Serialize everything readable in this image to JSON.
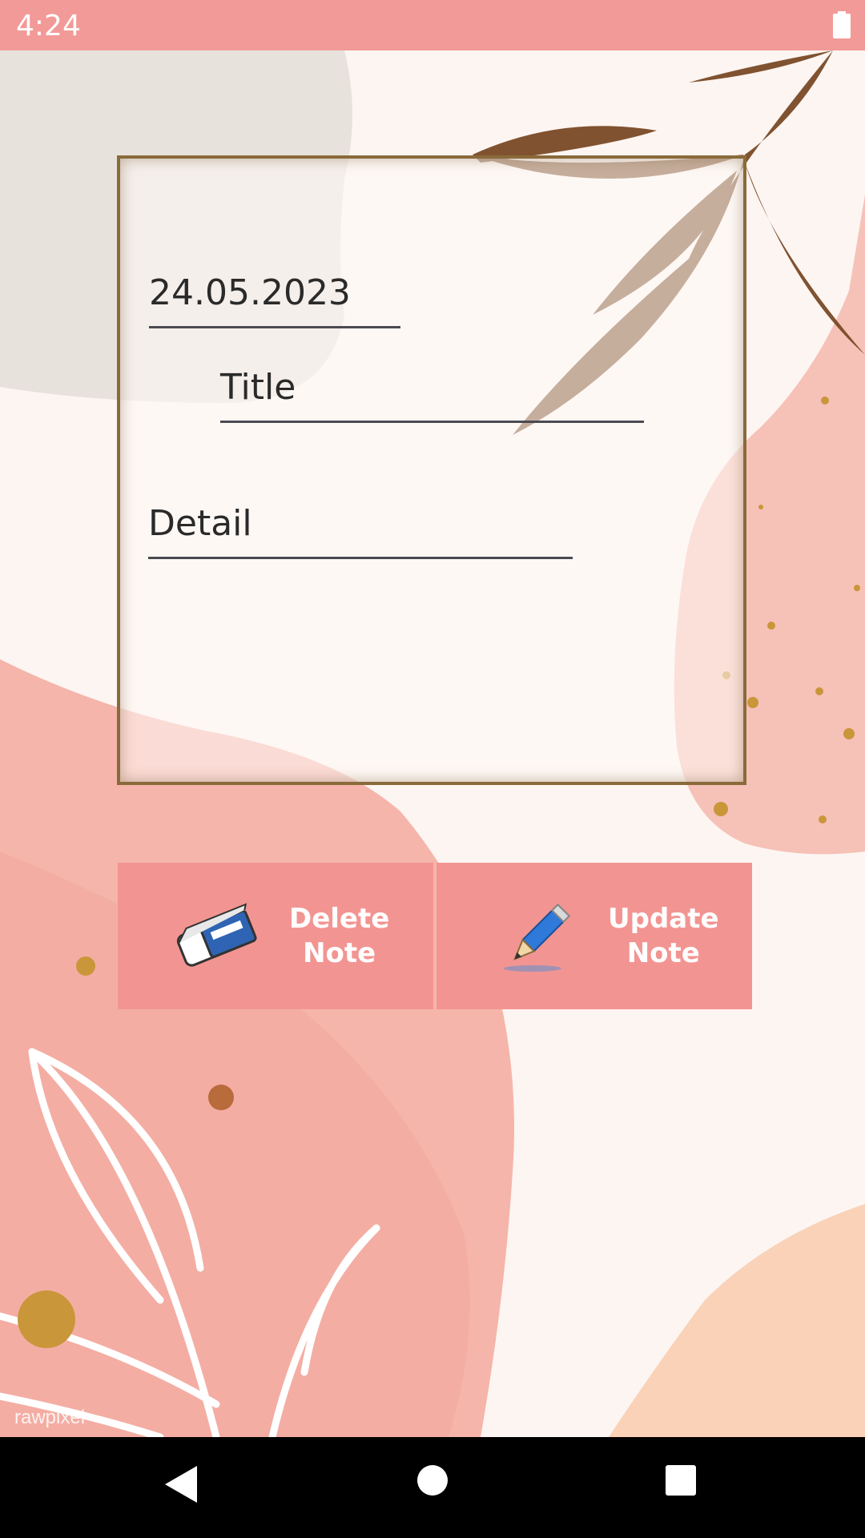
{
  "status_bar": {
    "time": "4:24"
  },
  "note": {
    "date": "24.05.2023",
    "title": "Title",
    "detail": "Detail"
  },
  "actions": {
    "delete_label_line1": "Delete",
    "delete_label_line2": "Note",
    "update_label_line1": "Update",
    "update_label_line2": "Note"
  },
  "watermark": "rawpixel",
  "colors": {
    "status_bar": "#f29a98",
    "button": "#f29592",
    "frame": "#8a6a3a"
  },
  "icons": {
    "delete": "eraser-icon",
    "update": "pencil-icon",
    "battery": "battery-icon",
    "back": "back-triangle-icon",
    "home": "home-circle-icon",
    "recents": "recents-square-icon"
  }
}
